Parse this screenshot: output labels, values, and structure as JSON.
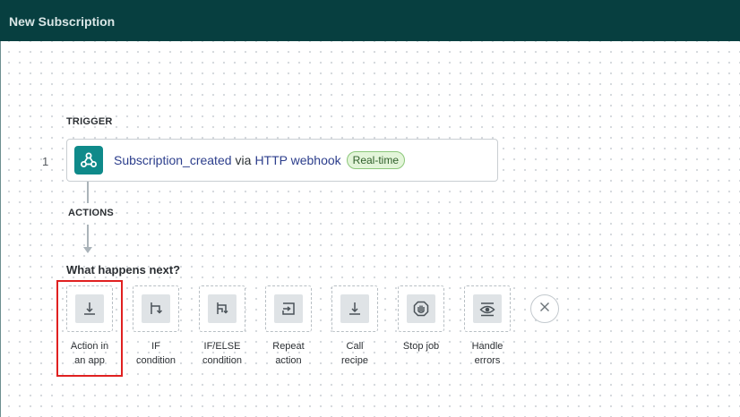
{
  "header": {
    "title": "New Subscription"
  },
  "trigger_section": {
    "label": "TRIGGER"
  },
  "trigger": {
    "step_number": "1",
    "event": "Subscription_created",
    "connector_word": "via",
    "source": "HTTP webhook",
    "badge": "Real-time"
  },
  "actions_section": {
    "label": "ACTIONS"
  },
  "next": {
    "question": "What happens next?",
    "options": [
      {
        "line1": "Action in",
        "line2": "an app",
        "icon": "action-in-app-icon",
        "selected": true
      },
      {
        "line1": "IF",
        "line2": "condition",
        "icon": "if-condition-icon"
      },
      {
        "line1": "IF/ELSE",
        "line2": "condition",
        "icon": "if-else-condition-icon"
      },
      {
        "line1": "Repeat",
        "line2": "action",
        "icon": "repeat-action-icon"
      },
      {
        "line1": "Call",
        "line2": "recipe",
        "icon": "call-recipe-icon"
      },
      {
        "line1": "Stop job",
        "line2": "",
        "icon": "stop-job-icon"
      },
      {
        "line1": "Handle",
        "line2": "errors",
        "icon": "handle-errors-icon"
      }
    ],
    "close_icon": "close-icon"
  },
  "colors": {
    "header_bg": "#073f40",
    "webhook_bg": "#0f8a8a",
    "link": "#2c3e8c",
    "badge_bg": "#e3f5d9",
    "highlight": "#e02020"
  }
}
